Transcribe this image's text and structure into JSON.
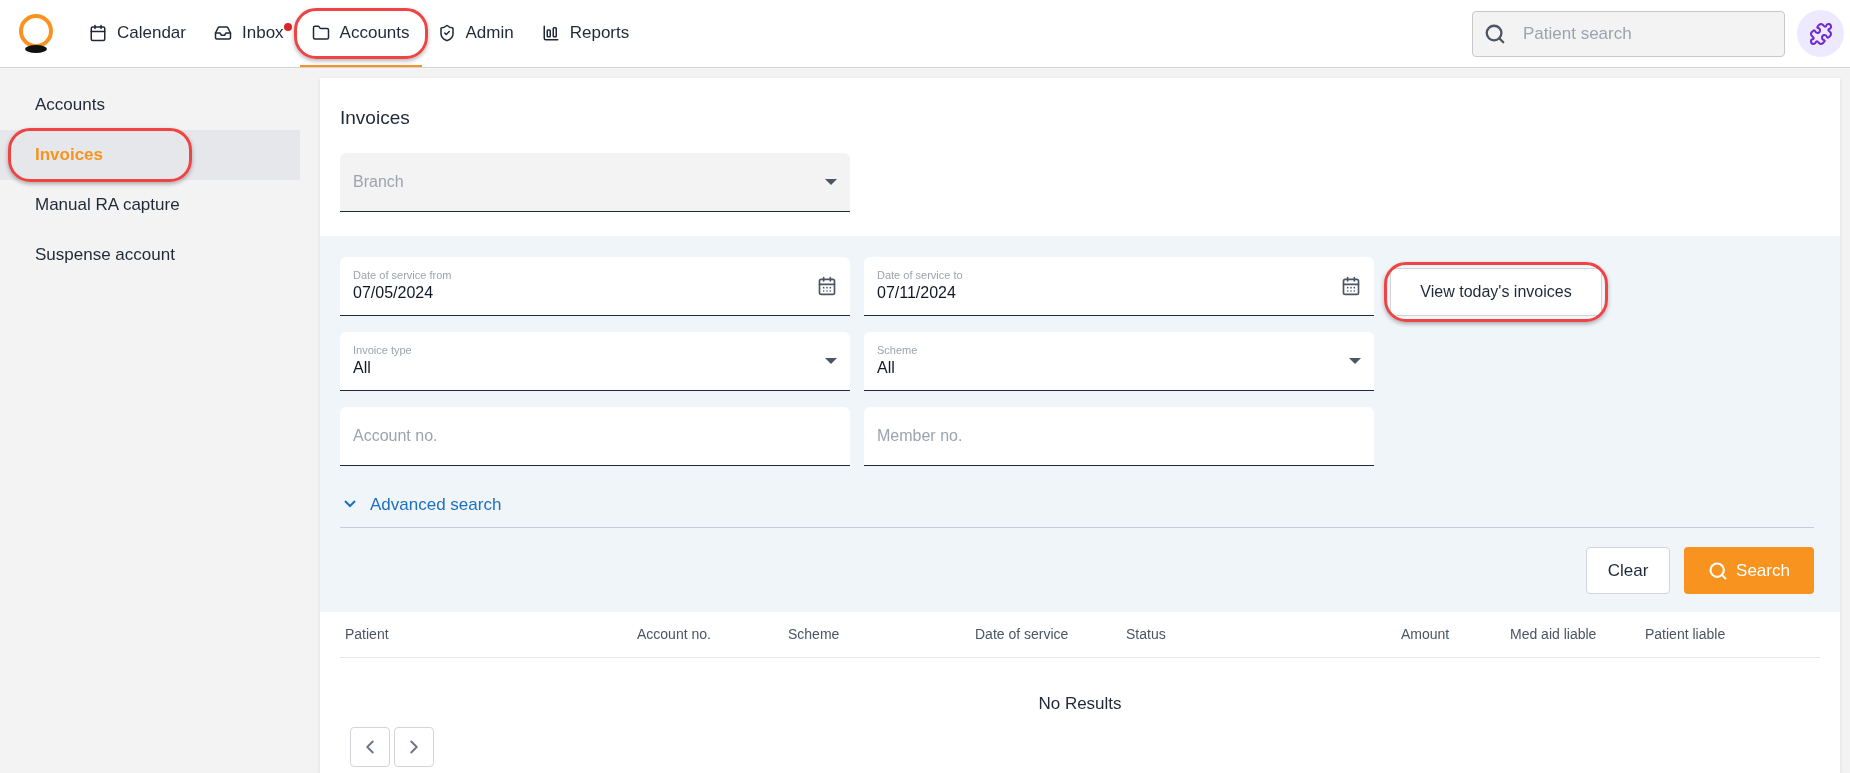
{
  "nav": {
    "items": [
      {
        "label": "Calendar",
        "selected": false,
        "badge": false,
        "highlighted": false
      },
      {
        "label": "Inbox",
        "selected": false,
        "badge": true,
        "highlighted": false
      },
      {
        "label": "Accounts",
        "selected": true,
        "badge": false,
        "highlighted": true
      },
      {
        "label": "Admin",
        "selected": false,
        "badge": false,
        "highlighted": false
      },
      {
        "label": "Reports",
        "selected": false,
        "badge": false,
        "highlighted": false
      }
    ],
    "search": {
      "placeholder": "Patient search"
    }
  },
  "sidebar": {
    "items": [
      {
        "label": "Accounts",
        "selected": false,
        "highlighted": false
      },
      {
        "label": "Invoices",
        "selected": true,
        "highlighted": true
      },
      {
        "label": "Manual RA capture",
        "selected": false,
        "highlighted": false
      },
      {
        "label": "Suspense account",
        "selected": false,
        "highlighted": false
      }
    ]
  },
  "page": {
    "title": "Invoices",
    "branch": {
      "placeholder": "Branch"
    }
  },
  "filters": {
    "rows": [
      [
        {
          "kind": "date",
          "label": "Date of service from",
          "value": "07/05/2024"
        },
        {
          "kind": "date",
          "label": "Date of service to",
          "value": "07/11/2024"
        }
      ],
      [
        {
          "kind": "select",
          "label": "Invoice type",
          "value": "All"
        },
        {
          "kind": "select",
          "label": "Scheme",
          "value": "All"
        }
      ],
      [
        {
          "kind": "text",
          "placeholder": "Account no."
        },
        {
          "kind": "text",
          "placeholder": "Member no."
        }
      ]
    ],
    "today_button": {
      "label": "View today's invoices",
      "highlighted": true
    },
    "advanced": "Advanced search",
    "clear": "Clear",
    "search": "Search"
  },
  "table": {
    "columns": [
      "Patient",
      "Account no.",
      "Scheme",
      "Date of service",
      "Status",
      "Amount",
      "Med aid liable",
      "Patient liable"
    ],
    "empty": "No Results"
  }
}
